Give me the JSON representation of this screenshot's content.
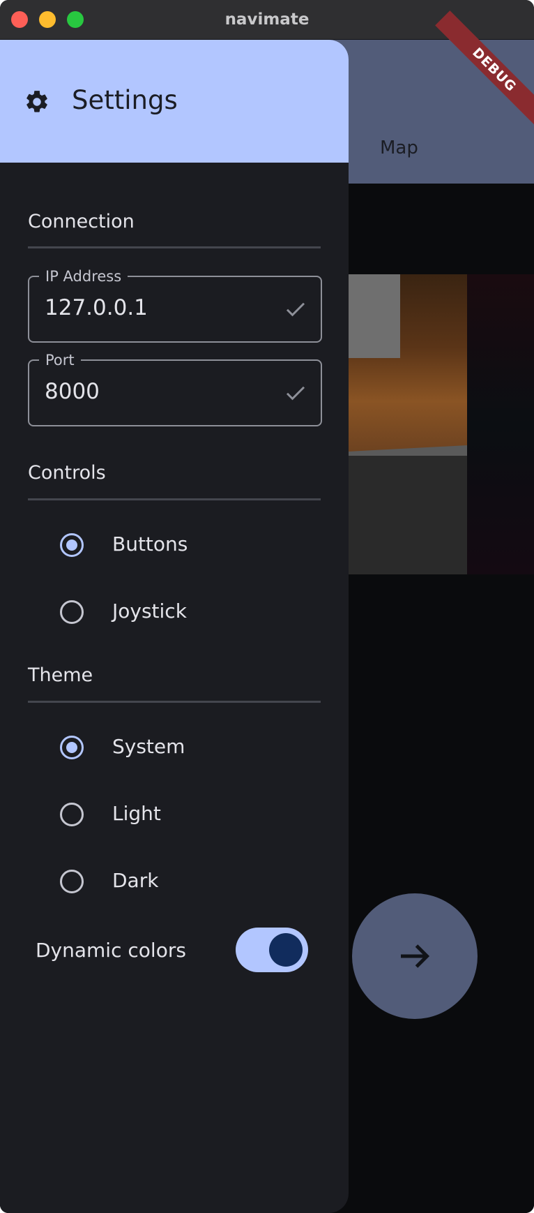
{
  "window": {
    "title": "navimate"
  },
  "app": {
    "tab_map_label": "Map",
    "debug_banner": "DEBUG",
    "fab_icon": "arrow-forward-icon"
  },
  "drawer": {
    "title": "Settings",
    "title_icon": "gear-icon",
    "connection": {
      "section_label": "Connection",
      "ip_label": "IP Address",
      "ip_value": "127.0.0.1",
      "port_label": "Port",
      "port_value": "8000"
    },
    "controls": {
      "section_label": "Controls",
      "options": [
        {
          "label": "Buttons",
          "selected": true
        },
        {
          "label": "Joystick",
          "selected": false
        }
      ]
    },
    "theme": {
      "section_label": "Theme",
      "options": [
        {
          "label": "System",
          "selected": true
        },
        {
          "label": "Light",
          "selected": false
        },
        {
          "label": "Dark",
          "selected": false
        }
      ]
    },
    "dynamic_colors": {
      "label": "Dynamic colors",
      "enabled": true
    }
  },
  "colors": {
    "primary": "#b2c6ff",
    "surface": "#1b1c21",
    "app_bar": "#525c79",
    "debug": "#8a2b2f"
  }
}
